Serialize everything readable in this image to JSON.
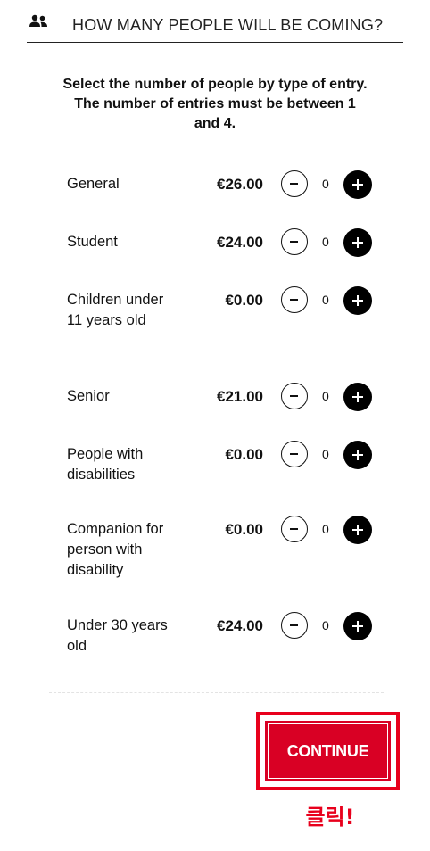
{
  "header": {
    "icon": "people-icon",
    "title": "HOW MANY PEOPLE WILL BE COMING?"
  },
  "instructions": "Select the number of people by type of entry. The number of entries must be between 1 and 4.",
  "tickets": [
    {
      "label": "General",
      "price": "€26.00",
      "count": "0"
    },
    {
      "label": "Student",
      "price": "€24.00",
      "count": "0"
    },
    {
      "label": "Children under 11 years old",
      "price": "€0.00",
      "count": "0"
    },
    {
      "label": "Senior",
      "price": "€21.00",
      "count": "0"
    },
    {
      "label": "People with disabilities",
      "price": "€0.00",
      "count": "0"
    },
    {
      "label": "Companion for person with disability",
      "price": "€0.00",
      "count": "0"
    },
    {
      "label": "Under 30 years old",
      "price": "€24.00",
      "count": "0"
    }
  ],
  "continue_label": "CONTINUE",
  "annotation": "클릭!",
  "colors": {
    "accent": "#d90024",
    "highlight": "#e8001c",
    "plus_button": "#000000"
  }
}
